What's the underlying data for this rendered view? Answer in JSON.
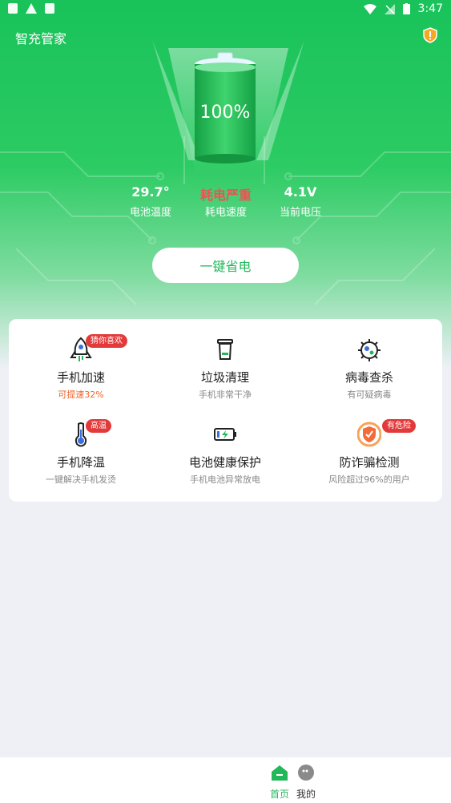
{
  "status_bar": {
    "time": "3:47"
  },
  "header": {
    "title": "智充管家"
  },
  "battery": {
    "percent": "100%"
  },
  "stats": [
    {
      "value": "29.7°",
      "label": "电池温度"
    },
    {
      "value": "耗电严重",
      "label": "耗电速度"
    },
    {
      "value": "4.1V",
      "label": "当前电压"
    }
  ],
  "action_button": {
    "label": "一键省电"
  },
  "features": [
    {
      "title": "手机加速",
      "subtitle": "可提速32%",
      "badge": "猜你喜欢",
      "icon": "rocket-icon"
    },
    {
      "title": "垃圾清理",
      "subtitle": "手机非常干净",
      "badge": "",
      "icon": "trash-icon"
    },
    {
      "title": "病毒查杀",
      "subtitle": "有可疑病毒",
      "badge": "",
      "icon": "virus-icon"
    },
    {
      "title": "手机降温",
      "subtitle": "一键解决手机发烫",
      "badge": "高温",
      "icon": "thermometer-icon"
    },
    {
      "title": "电池健康保护",
      "subtitle": "手机电池异常放电",
      "badge": "",
      "icon": "battery-charge-icon"
    },
    {
      "title": "防诈骗检测",
      "subtitle": "风险超过96%的用户",
      "badge": "有危险",
      "icon": "shield-check-icon"
    }
  ],
  "colors": {
    "brand": "#22b85a",
    "danger": "#e23a3a",
    "warn": "#f0642c"
  },
  "tabs": [
    {
      "label": "首页",
      "icon": "home-icon"
    },
    {
      "label": "我的",
      "icon": "profile-icon"
    }
  ]
}
